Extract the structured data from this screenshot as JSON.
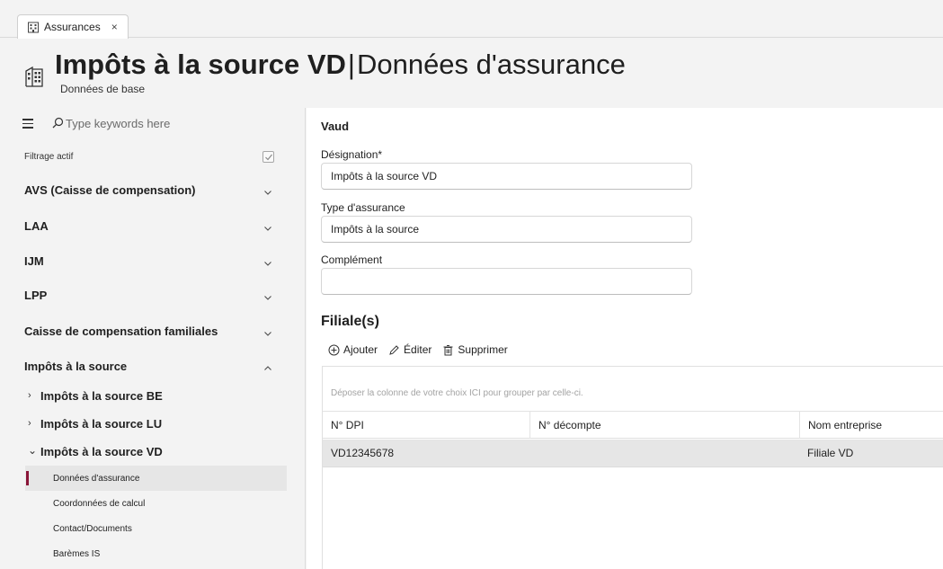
{
  "tab": {
    "label": "Assurances",
    "close": "×"
  },
  "header": {
    "title_bold": "Impôts à la source VD",
    "separator": "|",
    "title_light": "Données d'assurance",
    "subtitle": "Données de base"
  },
  "sidebar": {
    "search_placeholder": "Type keywords here",
    "filter_label": "Filtrage actif",
    "filter_checked": true,
    "sections": [
      {
        "label": "AVS (Caisse de compensation)",
        "expanded": false
      },
      {
        "label": "LAA",
        "expanded": false
      },
      {
        "label": "IJM",
        "expanded": false
      },
      {
        "label": "LPP",
        "expanded": false
      },
      {
        "label": "Caisse de compensation familiales",
        "expanded": false
      },
      {
        "label": "Impôts à la source",
        "expanded": true
      }
    ],
    "subsections": [
      {
        "label": "Impôts à la source BE",
        "caret": "›"
      },
      {
        "label": "Impôts à la source LU",
        "caret": "›"
      },
      {
        "label": "Impôts à la source VD",
        "caret": "⌄"
      }
    ],
    "leaves": [
      {
        "label": "Données d'assurance",
        "active": true
      },
      {
        "label": "Coordonnées de calcul",
        "active": false
      },
      {
        "label": "Contact/Documents",
        "active": false
      },
      {
        "label": "Barèmes IS",
        "active": false
      }
    ]
  },
  "main": {
    "section_title": "Vaud",
    "designation": {
      "label": "Désignation*",
      "value": "Impôts à la source VD"
    },
    "type": {
      "label": "Type d'assurance",
      "value": "Impôts à la source"
    },
    "complement": {
      "label": "Complément",
      "value": ""
    },
    "filiale_title": "Filiale(s)",
    "toolbar": {
      "add": "Ajouter",
      "edit": "Éditer",
      "delete": "Supprimer"
    },
    "grid": {
      "group_hint": "Déposer la colonne de votre choix ICI pour grouper par celle-ci.",
      "columns": [
        "N° DPI",
        "N° décompte",
        "Nom entreprise"
      ],
      "rows": [
        [
          "VD12345678",
          "",
          "Filiale VD"
        ]
      ]
    }
  },
  "colors": {
    "accent_marker": "#8a1538",
    "selected_row": "#e6e6e6"
  }
}
